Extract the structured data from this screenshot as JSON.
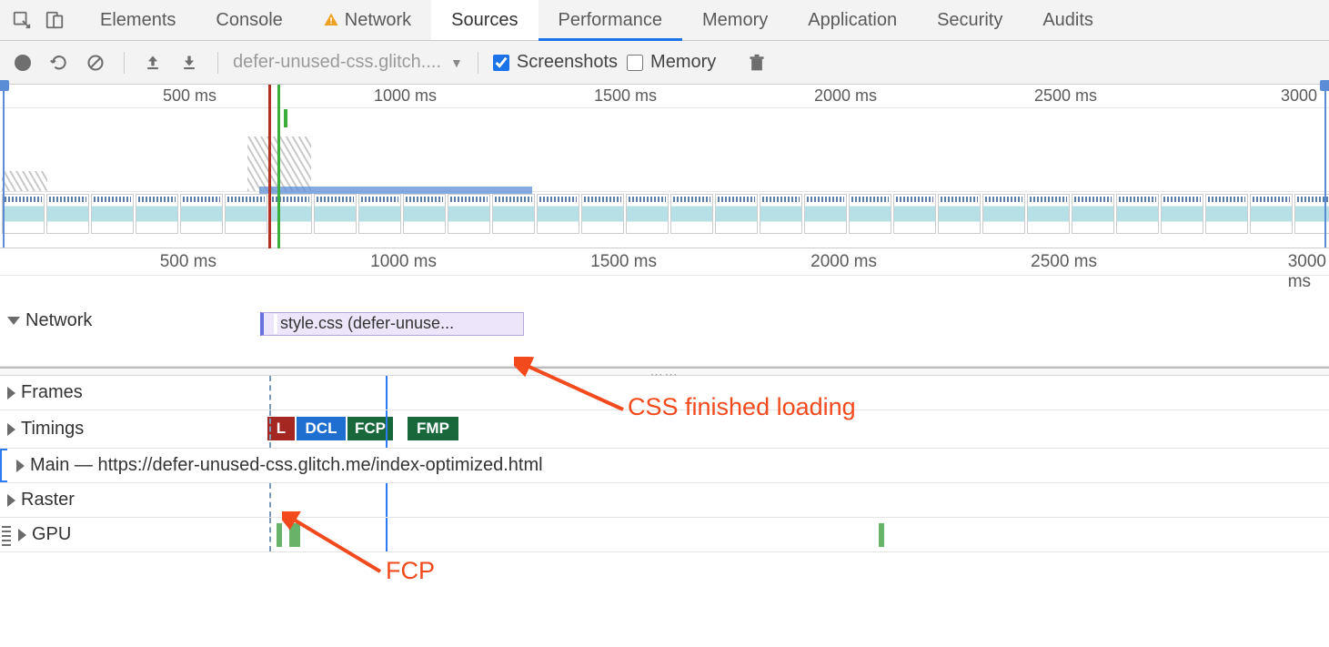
{
  "tabs": {
    "elements": "Elements",
    "console": "Console",
    "network": "Network",
    "sources": "Sources",
    "performance": "Performance",
    "memory": "Memory",
    "application": "Application",
    "security": "Security",
    "audits": "Audits"
  },
  "toolbar": {
    "dropdown_label": "defer-unused-css.glitch....",
    "screenshots_label": "Screenshots",
    "memory_label": "Memory"
  },
  "overview_ruler": {
    "t1": "500 ms",
    "t2": "1000 ms",
    "t3": "1500 ms",
    "t4": "2000 ms",
    "t5": "2500 ms",
    "t6": "3000"
  },
  "detail_ruler": {
    "t1": "500 ms",
    "t2": "1000 ms",
    "t3": "1500 ms",
    "t4": "2000 ms",
    "t5": "2500 ms",
    "t6": "3000 ms"
  },
  "tracks": {
    "network": "Network",
    "net_item": "style.css (defer-unuse...",
    "frames": "Frames",
    "timings": "Timings",
    "main": "Main — https://defer-unused-css.glitch.me/index-optimized.html",
    "raster": "Raster",
    "gpu": "GPU"
  },
  "timings": {
    "l": "L",
    "dcl": "DCL",
    "fcp": "FCP",
    "fmp": "FMP"
  },
  "annotations": {
    "css": "CSS finished loading",
    "fcp": "FCP"
  }
}
